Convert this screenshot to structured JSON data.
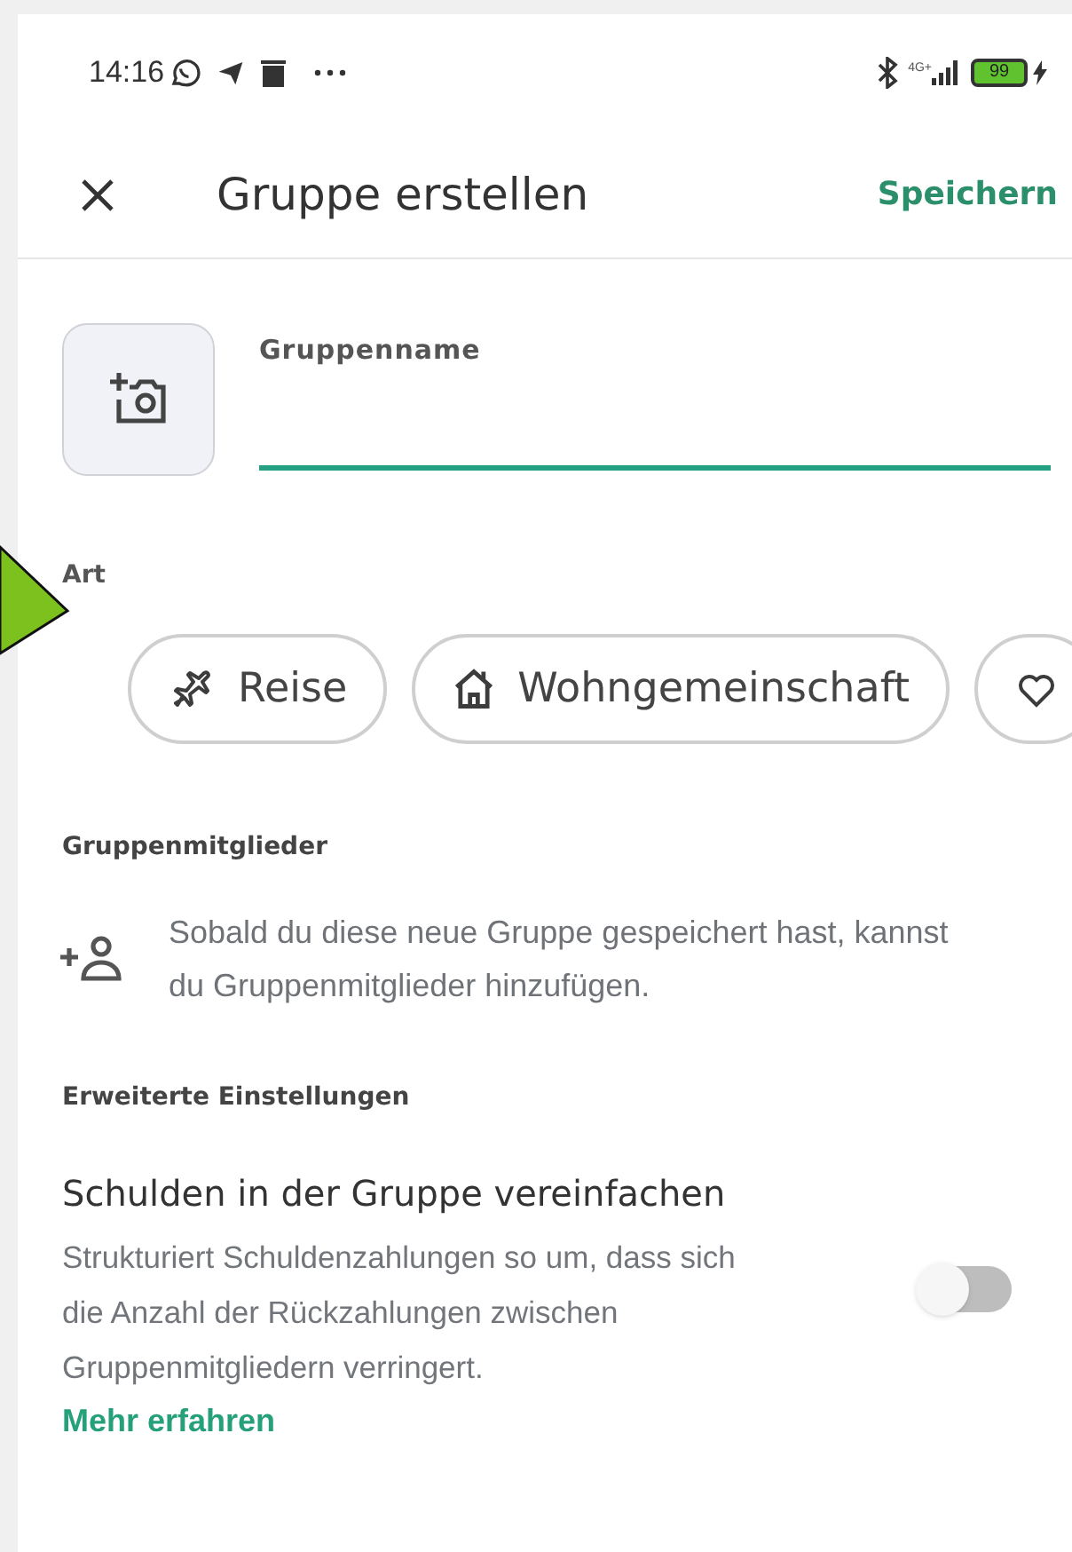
{
  "status_bar": {
    "time": "14:16",
    "network": "4G+",
    "battery": "99"
  },
  "header": {
    "title": "Gruppe erstellen",
    "action": "Speichern"
  },
  "group_name": {
    "label": "Gruppenname"
  },
  "type_section": {
    "label": "Art",
    "chips": [
      {
        "kind": "plane",
        "label": "Reise",
        "selected": false
      },
      {
        "kind": "house",
        "label": "Wohngemeinschaft",
        "selected": false
      },
      {
        "kind": "heart",
        "selected": false
      }
    ]
  },
  "members": {
    "heading": "Gruppenmitglieder",
    "info": "Sobald du diese neue Gruppe gespeichert hast, kannst du Gruppenmitglieder hinzufügen."
  },
  "advanced": {
    "heading": "Erweiterte Einstellungen",
    "setting": {
      "title": "Schulden in der Gruppe vereinfachen",
      "description": "Strukturiert Schuldenzahlungen so um, dass sich die Anzahl der Rückzahlungen zwischen Gruppenmitgliedern verringert.",
      "link": "Mehr erfahren",
      "on": false
    }
  }
}
